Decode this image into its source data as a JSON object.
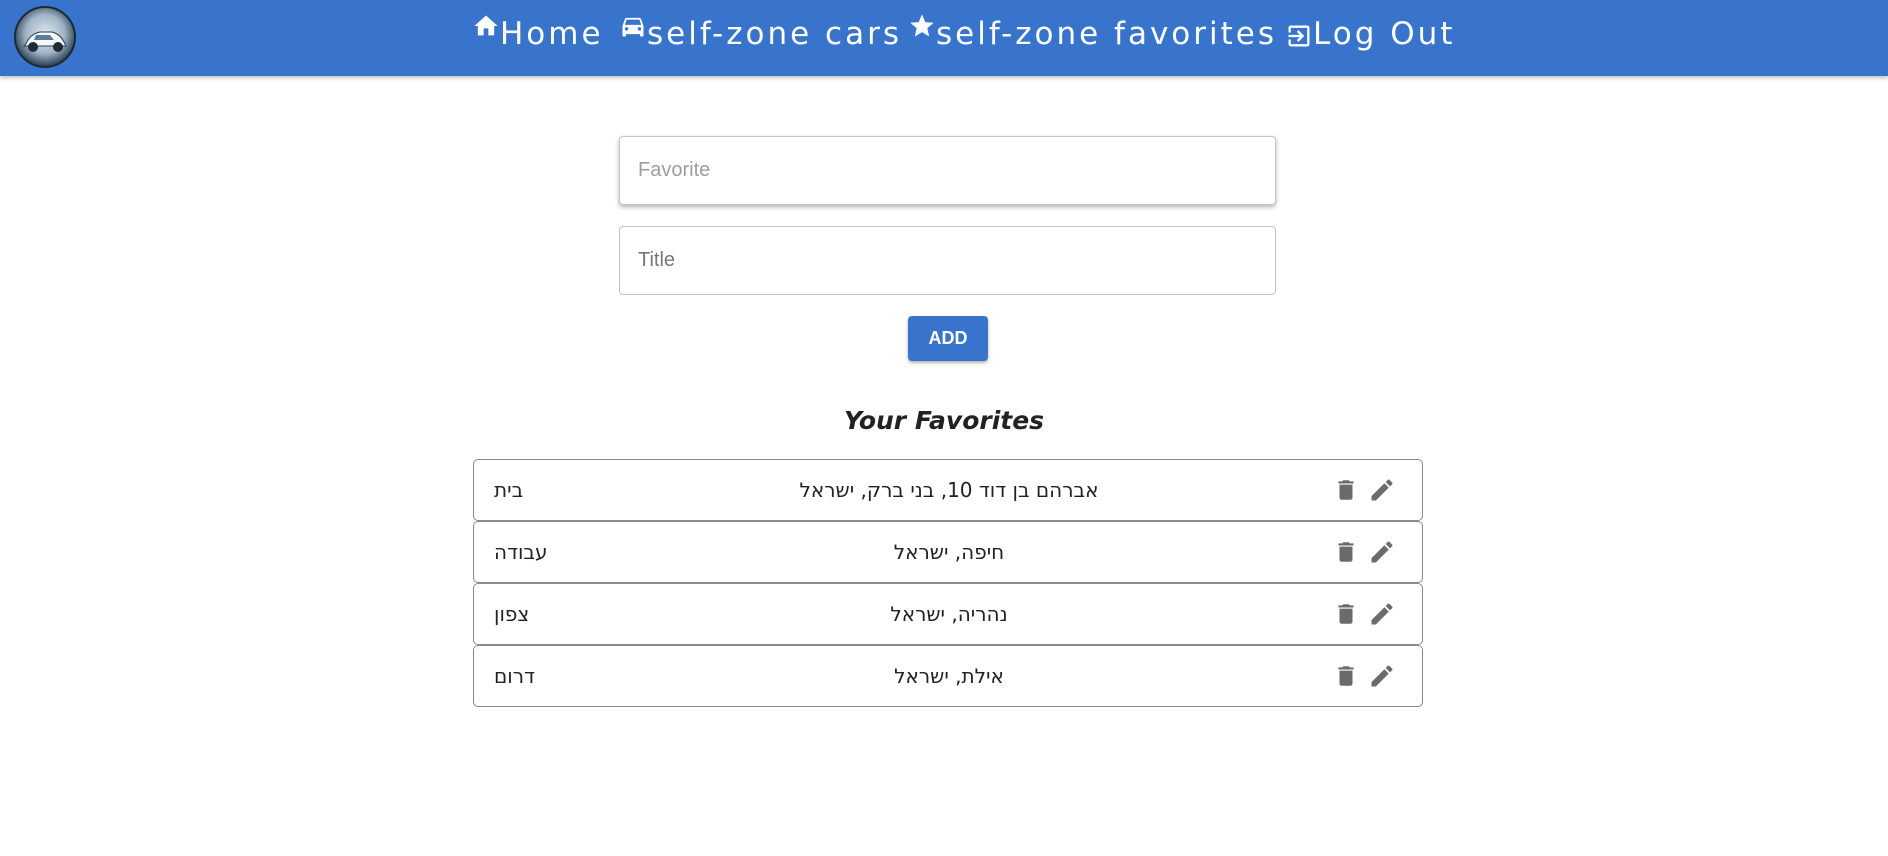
{
  "nav": {
    "logo_icon": "car-logo-icon",
    "items": [
      {
        "label": "Home",
        "icon": "home-icon"
      },
      {
        "label": "self-zone cars",
        "icon": "car-icon"
      },
      {
        "label": "self-zone favorites",
        "icon": "star-icon"
      },
      {
        "label": "Log Out",
        "icon": "logout-icon"
      }
    ]
  },
  "form": {
    "favorite_placeholder": "Favorite",
    "favorite_value": "",
    "title_placeholder": "Title",
    "title_value": "",
    "add_label": "ADD"
  },
  "favorites": {
    "heading": "Your Favorites",
    "items": [
      {
        "title": "בית",
        "address": "אברהם בן דוד 10, בני ברק, ישראל"
      },
      {
        "title": "עבודה",
        "address": "חיפה, ישראל"
      },
      {
        "title": "צפון",
        "address": "נהריה, ישראל"
      },
      {
        "title": "דרום",
        "address": "אילת, ישראל"
      }
    ]
  },
  "colors": {
    "appbar": "#3874cb",
    "button": "#3874cb",
    "icon_gray": "#6b6b6b"
  }
}
